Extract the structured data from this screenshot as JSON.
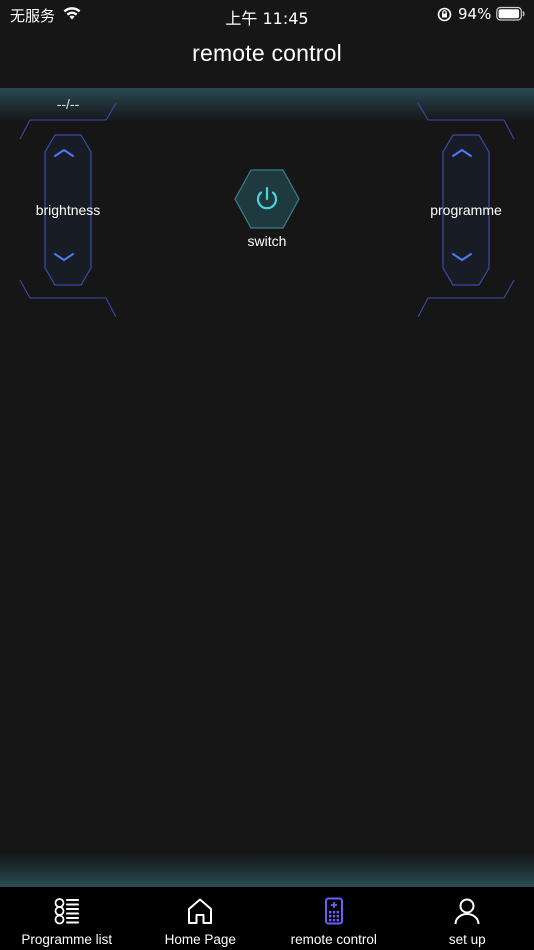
{
  "status": {
    "carrier": "无服务",
    "time": "上午 11:45",
    "battery": "94%"
  },
  "header": {
    "title": "remote control"
  },
  "remote": {
    "timer": "--/--",
    "brightness_label": "brightness",
    "programme_label": "programme",
    "switch_label": "switch"
  },
  "tabs": [
    {
      "label": "Programme list",
      "icon": "programme-list-icon",
      "active": false
    },
    {
      "label": "Home Page",
      "icon": "home-icon",
      "active": false
    },
    {
      "label": "remote control",
      "icon": "remote-control-icon",
      "active": true
    },
    {
      "label": "set up",
      "icon": "user-icon",
      "active": false
    }
  ],
  "colors": {
    "background": "#161616",
    "accent_blue": "#4a7bff",
    "accent_cyan": "#4fd1e6",
    "frame_purple": "#3b3f9e",
    "tab_bar": "#000000"
  }
}
